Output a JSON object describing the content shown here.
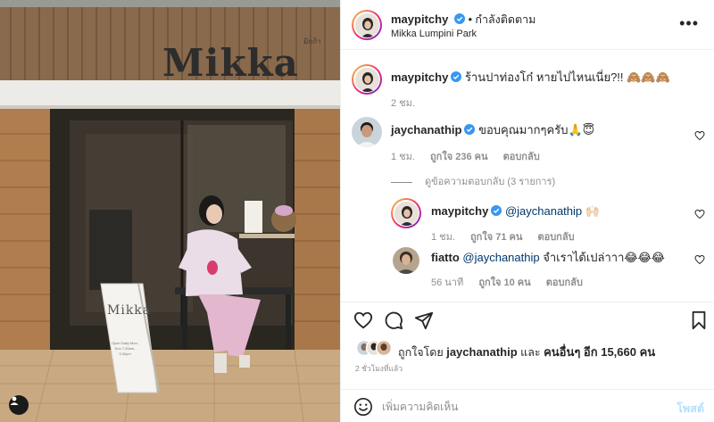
{
  "post": {
    "author": "maypitchy",
    "follow_status": "• กำลังติดตาม",
    "location": "Mikka Lumpini Park",
    "more_label": "•••",
    "photo": {
      "shop_name": "Mikka",
      "shop_sub": "มิกก้า",
      "sign_name": "Mikka",
      "sign_small": "Open Daily Mon-Sun 7.00am-3.30pm"
    }
  },
  "caption": {
    "username": "maypitchy",
    "text": "ร้านปาท่องโก๋ หายไปไหนเนี่ย?!! 🙈🙈🙈",
    "time": "2 ชม."
  },
  "comments": [
    {
      "username": "jaychanathip",
      "text": "ขอบคุณมากๆครับ🙏😇",
      "time": "1 ชม.",
      "likes": "ถูกใจ 236 คน",
      "reply_label": "ตอบกลับ"
    }
  ],
  "view_replies": "ดูข้อความตอบกลับ (3 รายการ)",
  "replies": [
    {
      "username": "maypitchy",
      "mention": "@jaychanathip",
      "text": " 🙌🏻",
      "time": "1 ชม.",
      "likes": "ถูกใจ 71 คน",
      "reply_label": "ตอบกลับ"
    },
    {
      "username": "fiatto",
      "mention": "@jaychanathip",
      "text": " จำเราได้เปล่าาา😂😂😂",
      "time": "56 นาที",
      "likes": "ถูกใจ 10 คน",
      "reply_label": "ตอบกลับ"
    }
  ],
  "likes": {
    "prefix": "ถูกใจโดย ",
    "user": "jaychanathip",
    "middle": " และ ",
    "others": "คนอื่นๆ อีก 15,660 คน"
  },
  "time_ago": "2 ชั่วโมงที่แล้ว",
  "add_comment": {
    "placeholder": "เพิ่มความคิดเห็น",
    "post_label": "โพสต์"
  },
  "colors": {
    "accent_blue": "#0095f6",
    "post_disabled": "#b2dffc",
    "verified": "#3897f0",
    "muted": "#8e8e8e"
  },
  "icons": [
    "heart-icon",
    "comment-icon",
    "share-icon",
    "bookmark-icon",
    "emoji-icon",
    "verified-badge-icon",
    "more-icon"
  ]
}
